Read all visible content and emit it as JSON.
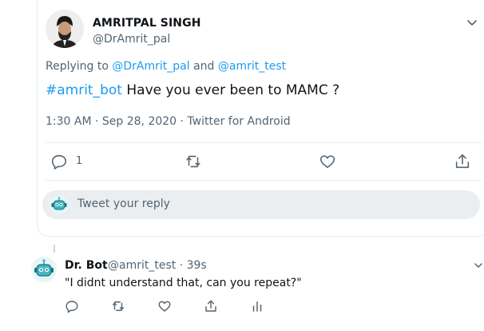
{
  "colors": {
    "accent": "#1d9bf0",
    "muted": "#536471",
    "text": "#0f1419",
    "divider": "#e6ecf0",
    "reply_box": "#ebeef0"
  },
  "tweet": {
    "author_name": "AMRITPAL SINGH",
    "author_handle": "@DrAmrit_pal",
    "replying_prefix": "Replying to",
    "replying_user1": "@DrAmrit_pal",
    "replying_and": "and",
    "replying_user2": "@amrit_test",
    "hashtag": "#amrit_bot",
    "text": "Have you ever been to MAMC ?",
    "timestamp": "1:30 AM · Sep 28, 2020 · Twitter for Android",
    "reply_count": "1",
    "icons": [
      "chevron-down-icon",
      "reply-icon",
      "retweet-icon",
      "like-icon",
      "share-icon"
    ]
  },
  "reply_box": {
    "placeholder": "Tweet your reply"
  },
  "bot_reply": {
    "author_name": "Dr. Bot",
    "handle_and_time": "@amrit_test · 39s",
    "text": "\"I didnt understand that, can you repeat?\"",
    "icons": [
      "reply-icon",
      "retweet-icon",
      "like-icon",
      "share-icon",
      "analytics-icon"
    ]
  }
}
